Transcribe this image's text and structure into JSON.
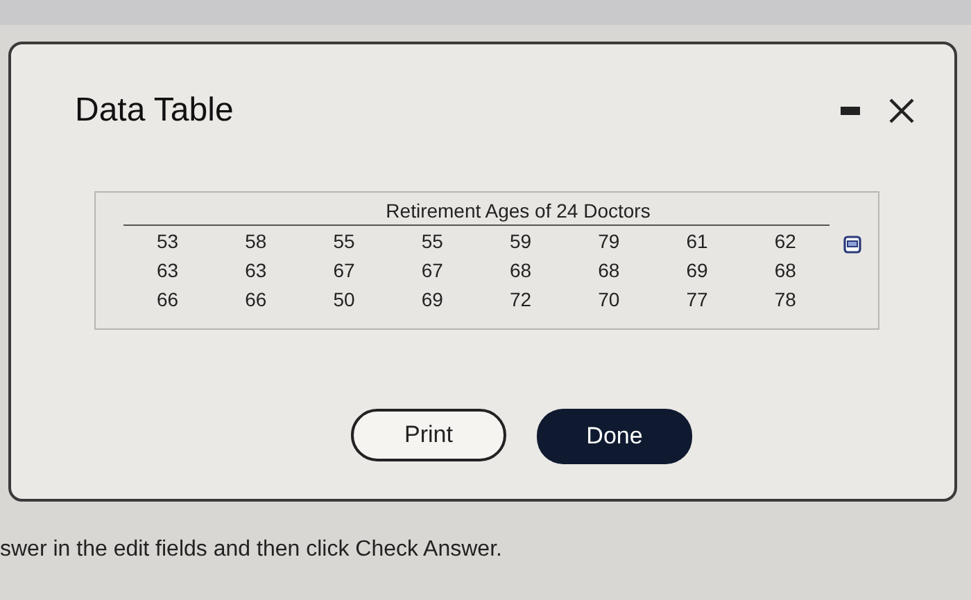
{
  "dialog": {
    "title": "Data Table",
    "table": {
      "caption": "Retirement Ages of 24 Doctors",
      "rows": [
        [
          "53",
          "58",
          "55",
          "55",
          "59",
          "79",
          "61",
          "62"
        ],
        [
          "63",
          "63",
          "67",
          "67",
          "68",
          "68",
          "69",
          "68"
        ],
        [
          "66",
          "66",
          "50",
          "69",
          "72",
          "70",
          "77",
          "78"
        ]
      ]
    },
    "buttons": [
      {
        "label": "Print",
        "kind": "outline"
      },
      {
        "label": "Done",
        "kind": "filled"
      }
    ]
  },
  "instruction": "swer in the edit fields and then click Check Answer."
}
